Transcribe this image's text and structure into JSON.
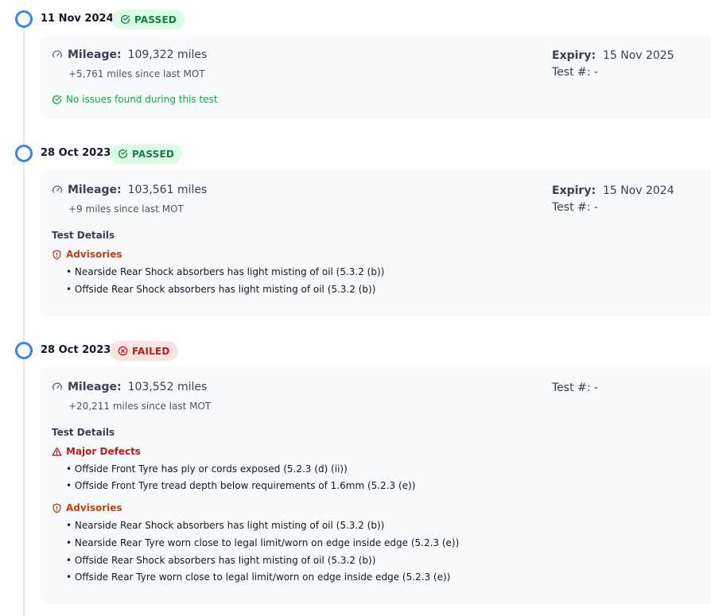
{
  "mot_history": [
    {
      "date": "11 Nov 2024",
      "status": "PASSED",
      "mileage_label": "Mileage:",
      "mileage": "109,322 miles",
      "since": "+5,761 miles since last MOT",
      "expiry_label": "Expiry:",
      "expiry": "15 Nov 2025",
      "test_label": "Test #:",
      "test_number": "-",
      "no_issues": "No issues found during this test"
    },
    {
      "date": "28 Oct 2023",
      "status": "PASSED",
      "mileage_label": "Mileage:",
      "mileage": "103,561 miles",
      "since": "+9 miles since last MOT",
      "expiry_label": "Expiry:",
      "expiry": "15 Nov 2024",
      "test_label": "Test #:",
      "test_number": "-",
      "details_title": "Test Details",
      "advisories_label": "Advisories",
      "advisories": [
        "• Nearside Rear Shock absorbers has light misting of oil (5.3.2 (b))",
        "• Offside Rear Shock absorbers has light misting of oil (5.3.2 (b))"
      ]
    },
    {
      "date": "28 Oct 2023",
      "status": "FAILED",
      "mileage_label": "Mileage:",
      "mileage": "103,552 miles",
      "since": "+20,211 miles since last MOT",
      "test_label": "Test #:",
      "test_number": "-",
      "details_title": "Test Details",
      "major_label": "Major Defects",
      "major_defects": [
        "• Offside Front Tyre has ply or cords exposed (5.2.3 (d) (ii))",
        "• Offside Front Tyre tread depth below requirements of 1.6mm (5.2.3 (e))"
      ],
      "advisories_label": "Advisories",
      "advisories": [
        "• Nearside Rear Shock absorbers has light misting of oil (5.3.2 (b))",
        "• Nearside Rear Tyre worn close to legal limit/worn on edge inside edge (5.2.3 (e))",
        "• Offside Rear Shock absorbers has light misting of oil (5.3.2 (b))",
        "• Offside Rear Tyre worn close to legal limit/worn on edge inside edge (5.2.3 (e))"
      ]
    }
  ],
  "colors": {
    "accent": "#3b82f6",
    "pass": "#15803d",
    "fail": "#b91c1c",
    "advisory": "#c2410c"
  },
  "icons": {
    "mileage": "gauge-icon",
    "pass": "check-circle-icon",
    "fail": "x-circle-icon",
    "advisory": "shield-alert-icon",
    "major": "warning-triangle-icon"
  }
}
